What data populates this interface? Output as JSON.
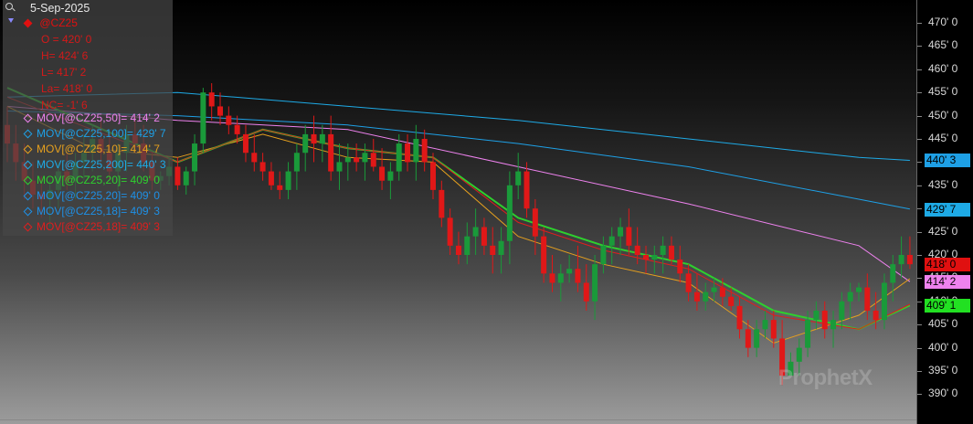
{
  "legend": {
    "date": "5-Sep-2025",
    "symbol": "@CZ25",
    "symbol_color": "#e01010",
    "ohlc": [
      {
        "label": "O = 420' 0"
      },
      {
        "label": "H= 424' 6"
      },
      {
        "label": "L= 417' 2"
      },
      {
        "label": "La= 418' 0"
      },
      {
        "label": "NC= -1' 6"
      }
    ],
    "studies": [
      {
        "label": "MOV[@CZ25,50]= 414' 2",
        "color": "#ee82ee"
      },
      {
        "label": "MOV[@CZ25,100]= 429' 7",
        "color": "#1ea0e6"
      },
      {
        "label": "MOV[@CZ25,10]= 414' 7",
        "color": "#e6a01e"
      },
      {
        "label": "MOV[@CZ25,200]= 440' 3",
        "color": "#1eaae6"
      },
      {
        "label": "MOV[@CZ25,20]= 409' 0",
        "color": "#2ed02e"
      },
      {
        "label": "MOV[@CZ25,20]= 409' 0",
        "color": "#1e90e6"
      },
      {
        "label": "MOV[@CZ25,18]= 409' 3",
        "color": "#1e90e6"
      },
      {
        "label": "MOV[@CZ25,18]= 409' 3",
        "color": "#e01e1e"
      }
    ]
  },
  "axis": {
    "ticks": [
      "470' 0",
      "465' 0",
      "460' 0",
      "455' 0",
      "450' 0",
      "445' 0",
      "440' 0",
      "435' 0",
      "430' 0",
      "425' 0",
      "420' 0",
      "415' 0",
      "410' 0",
      "405' 0",
      "400' 0",
      "395' 0",
      "390' 0"
    ],
    "badges": [
      {
        "label": "440' 3",
        "value": 440.375,
        "bg": "#1ea0e6",
        "fg": "#000000"
      },
      {
        "label": "429' 7",
        "value": 429.875,
        "bg": "#1eaae6",
        "fg": "#000000"
      },
      {
        "label": "418' 0",
        "value": 418.0,
        "bg": "#e01010",
        "fg": "#000000"
      },
      {
        "label": "414' 2",
        "value": 414.25,
        "bg": "#ee82ee",
        "fg": "#000000"
      },
      {
        "label": "409' 1",
        "value": 409.125,
        "bg": "#22e022",
        "fg": "#000000"
      }
    ]
  },
  "watermark": "ProphetX",
  "chart_data": {
    "type": "candlestick",
    "symbol": "@CZ25",
    "ylim": [
      387,
      472
    ],
    "candles": [
      [
        448,
        452,
        440,
        444
      ],
      [
        444,
        448,
        436,
        440
      ],
      [
        440,
        444,
        432,
        436
      ],
      [
        436,
        440,
        430,
        433
      ],
      [
        433,
        437,
        428,
        432
      ],
      [
        432,
        436,
        426,
        434
      ],
      [
        434,
        440,
        430,
        438
      ],
      [
        438,
        442,
        434,
        436
      ],
      [
        436,
        442,
        432,
        440
      ],
      [
        440,
        446,
        436,
        442
      ],
      [
        442,
        448,
        438,
        445
      ],
      [
        445,
        449,
        440,
        442
      ],
      [
        442,
        446,
        436,
        438
      ],
      [
        438,
        444,
        434,
        442
      ],
      [
        442,
        448,
        438,
        446
      ],
      [
        446,
        450,
        442,
        444
      ],
      [
        444,
        448,
        438,
        440
      ],
      [
        440,
        442,
        434,
        436
      ],
      [
        436,
        438,
        434,
        437
      ],
      [
        437,
        441,
        435,
        439
      ],
      [
        439,
        441,
        434,
        435
      ],
      [
        435,
        439,
        433,
        438
      ],
      [
        438,
        446,
        435,
        444
      ],
      [
        444,
        456,
        442,
        455
      ],
      [
        455,
        457,
        449,
        452
      ],
      [
        452,
        455,
        448,
        450
      ],
      [
        450,
        452,
        446,
        448
      ],
      [
        448,
        450,
        444,
        446
      ],
      [
        446,
        448,
        440,
        442
      ],
      [
        442,
        446,
        438,
        440
      ],
      [
        440,
        442,
        436,
        438
      ],
      [
        438,
        440,
        434,
        435
      ],
      [
        435,
        438,
        432,
        434
      ],
      [
        434,
        440,
        432,
        438
      ],
      [
        438,
        444,
        434,
        442
      ],
      [
        442,
        448,
        438,
        446
      ],
      [
        446,
        450,
        440,
        444
      ],
      [
        444,
        448,
        440,
        446
      ],
      [
        446,
        450,
        436,
        438
      ],
      [
        438,
        444,
        434,
        440
      ],
      [
        440,
        444,
        436,
        441
      ],
      [
        441,
        444,
        438,
        440
      ],
      [
        440,
        444,
        436,
        442
      ],
      [
        442,
        445,
        438,
        439
      ],
      [
        439,
        443,
        434,
        436
      ],
      [
        436,
        440,
        432,
        438
      ],
      [
        438,
        446,
        436,
        444
      ],
      [
        444,
        446,
        438,
        440
      ],
      [
        440,
        448,
        436,
        445
      ],
      [
        445,
        447,
        438,
        440
      ],
      [
        440,
        442,
        432,
        434
      ],
      [
        434,
        436,
        426,
        428
      ],
      [
        428,
        430,
        420,
        422
      ],
      [
        422,
        425,
        418,
        420
      ],
      [
        420,
        427,
        418,
        424
      ],
      [
        424,
        430,
        420,
        426
      ],
      [
        426,
        428,
        420,
        422
      ],
      [
        422,
        426,
        416,
        420
      ],
      [
        420,
        426,
        416,
        423
      ],
      [
        423,
        438,
        418,
        435
      ],
      [
        435,
        442,
        432,
        438
      ],
      [
        438,
        440,
        428,
        430
      ],
      [
        430,
        432,
        420,
        424
      ],
      [
        424,
        426,
        414,
        416
      ],
      [
        416,
        420,
        412,
        414
      ],
      [
        414,
        418,
        410,
        416
      ],
      [
        416,
        420,
        414,
        417
      ],
      [
        417,
        422,
        412,
        414
      ],
      [
        414,
        418,
        408,
        410
      ],
      [
        410,
        420,
        406,
        418
      ],
      [
        418,
        424,
        416,
        422
      ],
      [
        422,
        426,
        418,
        424
      ],
      [
        424,
        428,
        420,
        426
      ],
      [
        426,
        430,
        420,
        422
      ],
      [
        422,
        426,
        418,
        420
      ],
      [
        420,
        422,
        416,
        419
      ],
      [
        419,
        422,
        416,
        420
      ],
      [
        420,
        424,
        416,
        422
      ],
      [
        422,
        424,
        418,
        419
      ],
      [
        419,
        422,
        414,
        416
      ],
      [
        416,
        418,
        410,
        412
      ],
      [
        412,
        416,
        408,
        410
      ],
      [
        410,
        414,
        408,
        412
      ],
      [
        412,
        415,
        410,
        413
      ],
      [
        413,
        415,
        409,
        411
      ],
      [
        411,
        413,
        408,
        409
      ],
      [
        409,
        411,
        402,
        404
      ],
      [
        404,
        406,
        398,
        400
      ],
      [
        400,
        406,
        398,
        404
      ],
      [
        404,
        408,
        402,
        406
      ],
      [
        406,
        408,
        400,
        402
      ],
      [
        402,
        406,
        392,
        394
      ],
      [
        394,
        399,
        394,
        397
      ],
      [
        397,
        402,
        394,
        400
      ],
      [
        400,
        408,
        398,
        406
      ],
      [
        406,
        410,
        404,
        408
      ],
      [
        408,
        410,
        402,
        404
      ],
      [
        404,
        408,
        400,
        406
      ],
      [
        406,
        412,
        404,
        410
      ],
      [
        410,
        414,
        406,
        412
      ],
      [
        412,
        414,
        410,
        413
      ],
      [
        413,
        416,
        406,
        408
      ],
      [
        408,
        412,
        404,
        406
      ],
      [
        406,
        416,
        404,
        414
      ],
      [
        414,
        420,
        410,
        418
      ],
      [
        418,
        424,
        415,
        420
      ],
      [
        420,
        424,
        417,
        418
      ]
    ],
    "moving_averages": [
      {
        "name": "MOV[@CZ25,50]",
        "color": "#ee82ee",
        "points": [
          [
            0,
            452
          ],
          [
            20,
            449
          ],
          [
            40,
            447
          ],
          [
            60,
            439
          ],
          [
            80,
            431
          ],
          [
            100,
            422
          ],
          [
            106,
            414.25
          ]
        ]
      },
      {
        "name": "MOV[@CZ25,100]",
        "color": "#1ea0e6",
        "points": [
          [
            0,
            451
          ],
          [
            20,
            450
          ],
          [
            40,
            448
          ],
          [
            60,
            444
          ],
          [
            80,
            439
          ],
          [
            100,
            432
          ],
          [
            106,
            429.875
          ]
        ]
      },
      {
        "name": "MOV[@CZ25,200]",
        "color": "#1eaae6",
        "points": [
          [
            0,
            454
          ],
          [
            20,
            455
          ],
          [
            40,
            452
          ],
          [
            60,
            449
          ],
          [
            80,
            445
          ],
          [
            100,
            441
          ],
          [
            106,
            440.375
          ]
        ]
      },
      {
        "name": "MOV[@CZ25,10]",
        "color": "#e6a01e",
        "points": [
          [
            0,
            452
          ],
          [
            10,
            443
          ],
          [
            20,
            441
          ],
          [
            30,
            446
          ],
          [
            40,
            441
          ],
          [
            50,
            440
          ],
          [
            60,
            424
          ],
          [
            70,
            418
          ],
          [
            80,
            414
          ],
          [
            90,
            401
          ],
          [
            100,
            407
          ],
          [
            106,
            414.875
          ]
        ]
      },
      {
        "name": "MOV[@CZ25,20]",
        "color": "#2ed02e",
        "points": [
          [
            0,
            456
          ],
          [
            10,
            448
          ],
          [
            20,
            440
          ],
          [
            30,
            447
          ],
          [
            40,
            443
          ],
          [
            50,
            441
          ],
          [
            60,
            428
          ],
          [
            70,
            422
          ],
          [
            80,
            418
          ],
          [
            90,
            408
          ],
          [
            100,
            404
          ],
          [
            106,
            409.125
          ]
        ]
      },
      {
        "name": "MOV[@CZ25,18]",
        "color": "#e01e1e",
        "points": [
          [
            0,
            454
          ],
          [
            10,
            447
          ],
          [
            20,
            440
          ],
          [
            30,
            447
          ],
          [
            40,
            443
          ],
          [
            50,
            441
          ],
          [
            60,
            427
          ],
          [
            70,
            421
          ],
          [
            80,
            417
          ],
          [
            90,
            407
          ],
          [
            100,
            404
          ],
          [
            106,
            409.375
          ]
        ]
      }
    ]
  }
}
